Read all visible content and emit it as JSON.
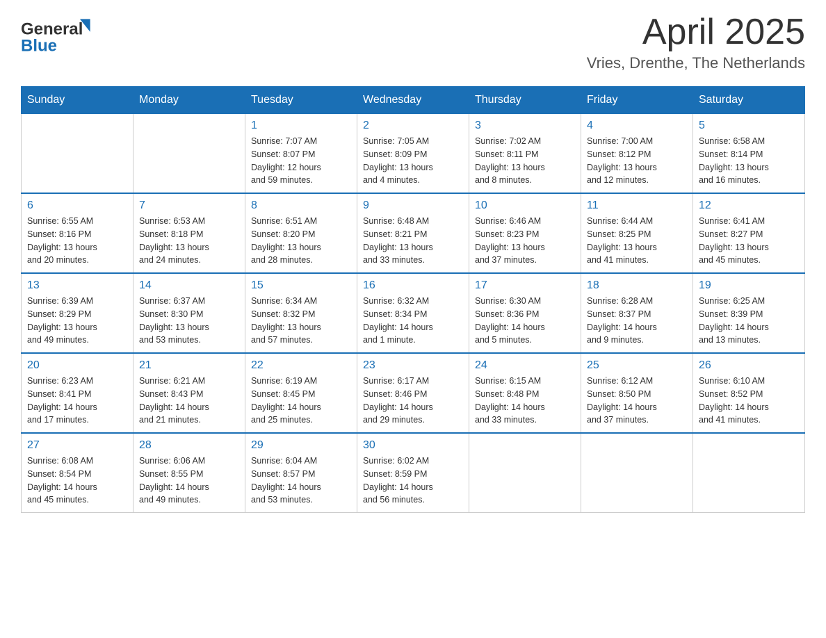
{
  "header": {
    "logo_general": "General",
    "logo_blue": "Blue",
    "month": "April 2025",
    "location": "Vries, Drenthe, The Netherlands"
  },
  "calendar": {
    "days_of_week": [
      "Sunday",
      "Monday",
      "Tuesday",
      "Wednesday",
      "Thursday",
      "Friday",
      "Saturday"
    ],
    "weeks": [
      [
        {
          "day": "",
          "info": ""
        },
        {
          "day": "",
          "info": ""
        },
        {
          "day": "1",
          "info": "Sunrise: 7:07 AM\nSunset: 8:07 PM\nDaylight: 12 hours\nand 59 minutes."
        },
        {
          "day": "2",
          "info": "Sunrise: 7:05 AM\nSunset: 8:09 PM\nDaylight: 13 hours\nand 4 minutes."
        },
        {
          "day": "3",
          "info": "Sunrise: 7:02 AM\nSunset: 8:11 PM\nDaylight: 13 hours\nand 8 minutes."
        },
        {
          "day": "4",
          "info": "Sunrise: 7:00 AM\nSunset: 8:12 PM\nDaylight: 13 hours\nand 12 minutes."
        },
        {
          "day": "5",
          "info": "Sunrise: 6:58 AM\nSunset: 8:14 PM\nDaylight: 13 hours\nand 16 minutes."
        }
      ],
      [
        {
          "day": "6",
          "info": "Sunrise: 6:55 AM\nSunset: 8:16 PM\nDaylight: 13 hours\nand 20 minutes."
        },
        {
          "day": "7",
          "info": "Sunrise: 6:53 AM\nSunset: 8:18 PM\nDaylight: 13 hours\nand 24 minutes."
        },
        {
          "day": "8",
          "info": "Sunrise: 6:51 AM\nSunset: 8:20 PM\nDaylight: 13 hours\nand 28 minutes."
        },
        {
          "day": "9",
          "info": "Sunrise: 6:48 AM\nSunset: 8:21 PM\nDaylight: 13 hours\nand 33 minutes."
        },
        {
          "day": "10",
          "info": "Sunrise: 6:46 AM\nSunset: 8:23 PM\nDaylight: 13 hours\nand 37 minutes."
        },
        {
          "day": "11",
          "info": "Sunrise: 6:44 AM\nSunset: 8:25 PM\nDaylight: 13 hours\nand 41 minutes."
        },
        {
          "day": "12",
          "info": "Sunrise: 6:41 AM\nSunset: 8:27 PM\nDaylight: 13 hours\nand 45 minutes."
        }
      ],
      [
        {
          "day": "13",
          "info": "Sunrise: 6:39 AM\nSunset: 8:29 PM\nDaylight: 13 hours\nand 49 minutes."
        },
        {
          "day": "14",
          "info": "Sunrise: 6:37 AM\nSunset: 8:30 PM\nDaylight: 13 hours\nand 53 minutes."
        },
        {
          "day": "15",
          "info": "Sunrise: 6:34 AM\nSunset: 8:32 PM\nDaylight: 13 hours\nand 57 minutes."
        },
        {
          "day": "16",
          "info": "Sunrise: 6:32 AM\nSunset: 8:34 PM\nDaylight: 14 hours\nand 1 minute."
        },
        {
          "day": "17",
          "info": "Sunrise: 6:30 AM\nSunset: 8:36 PM\nDaylight: 14 hours\nand 5 minutes."
        },
        {
          "day": "18",
          "info": "Sunrise: 6:28 AM\nSunset: 8:37 PM\nDaylight: 14 hours\nand 9 minutes."
        },
        {
          "day": "19",
          "info": "Sunrise: 6:25 AM\nSunset: 8:39 PM\nDaylight: 14 hours\nand 13 minutes."
        }
      ],
      [
        {
          "day": "20",
          "info": "Sunrise: 6:23 AM\nSunset: 8:41 PM\nDaylight: 14 hours\nand 17 minutes."
        },
        {
          "day": "21",
          "info": "Sunrise: 6:21 AM\nSunset: 8:43 PM\nDaylight: 14 hours\nand 21 minutes."
        },
        {
          "day": "22",
          "info": "Sunrise: 6:19 AM\nSunset: 8:45 PM\nDaylight: 14 hours\nand 25 minutes."
        },
        {
          "day": "23",
          "info": "Sunrise: 6:17 AM\nSunset: 8:46 PM\nDaylight: 14 hours\nand 29 minutes."
        },
        {
          "day": "24",
          "info": "Sunrise: 6:15 AM\nSunset: 8:48 PM\nDaylight: 14 hours\nand 33 minutes."
        },
        {
          "day": "25",
          "info": "Sunrise: 6:12 AM\nSunset: 8:50 PM\nDaylight: 14 hours\nand 37 minutes."
        },
        {
          "day": "26",
          "info": "Sunrise: 6:10 AM\nSunset: 8:52 PM\nDaylight: 14 hours\nand 41 minutes."
        }
      ],
      [
        {
          "day": "27",
          "info": "Sunrise: 6:08 AM\nSunset: 8:54 PM\nDaylight: 14 hours\nand 45 minutes."
        },
        {
          "day": "28",
          "info": "Sunrise: 6:06 AM\nSunset: 8:55 PM\nDaylight: 14 hours\nand 49 minutes."
        },
        {
          "day": "29",
          "info": "Sunrise: 6:04 AM\nSunset: 8:57 PM\nDaylight: 14 hours\nand 53 minutes."
        },
        {
          "day": "30",
          "info": "Sunrise: 6:02 AM\nSunset: 8:59 PM\nDaylight: 14 hours\nand 56 minutes."
        },
        {
          "day": "",
          "info": ""
        },
        {
          "day": "",
          "info": ""
        },
        {
          "day": "",
          "info": ""
        }
      ]
    ]
  }
}
